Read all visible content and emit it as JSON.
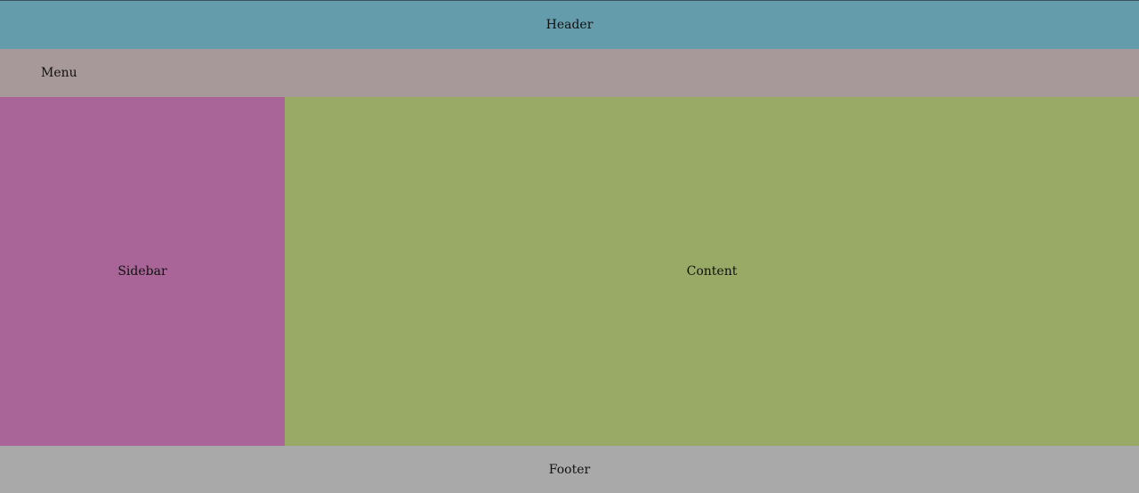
{
  "header": {
    "label": "Header",
    "color": "#659cab"
  },
  "menu": {
    "label": "Menu",
    "color": "#a79999"
  },
  "sidebar": {
    "label": "Sidebar",
    "color": "#a96597"
  },
  "content": {
    "label": "Content",
    "color": "#99a966"
  },
  "footer": {
    "label": "Footer",
    "color": "#a9a9a9"
  }
}
